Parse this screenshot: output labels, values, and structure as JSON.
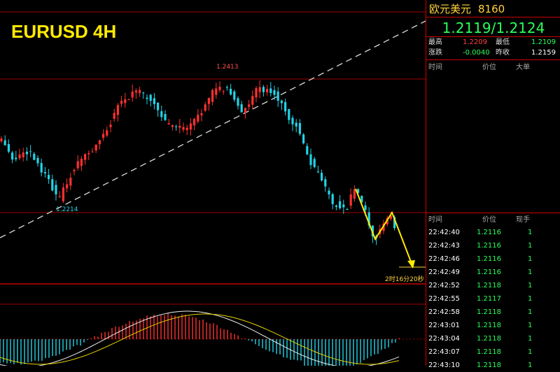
{
  "chart_data": {
    "type": "candlestick",
    "title": "EURUSD 4H",
    "annotations": {
      "high_label": "1.2413",
      "low_label": "1.2214",
      "countdown": "2时16分20秒"
    }
  },
  "panel": {
    "title_name": "欧元美元",
    "title_code": "8160",
    "quote": "1.2119/1.2124",
    "stats": {
      "high_label": "最高",
      "high_value": "1.2209",
      "low_label": "最低",
      "low_value": "1.2109",
      "change_label": "涨跌",
      "change_value": "-0.0040",
      "prev_label": "昨收",
      "prev_value": "1.2159"
    },
    "big_orders_header": {
      "time": "时间",
      "price": "价位",
      "size": "大单"
    },
    "ticks_header": {
      "time": "时间",
      "price": "价位",
      "size": "现手"
    },
    "ticks": [
      {
        "time": "22:42:40",
        "price": "1.2116",
        "size": "1"
      },
      {
        "time": "22:42:43",
        "price": "1.2116",
        "size": "1"
      },
      {
        "time": "22:42:46",
        "price": "1.2116",
        "size": "1"
      },
      {
        "time": "22:42:49",
        "price": "1.2116",
        "size": "1"
      },
      {
        "time": "22:42:52",
        "price": "1.2118",
        "size": "1"
      },
      {
        "time": "22:42:55",
        "price": "1.2117",
        "size": "1"
      },
      {
        "time": "22:42:58",
        "price": "1.2118",
        "size": "1"
      },
      {
        "time": "22:43:01",
        "price": "1.2118",
        "size": "1"
      },
      {
        "time": "22:43:04",
        "price": "1.2118",
        "size": "1"
      },
      {
        "time": "22:43:07",
        "price": "1.2118",
        "size": "1"
      },
      {
        "time": "22:43:10",
        "price": "1.2118",
        "size": "1"
      }
    ]
  },
  "colors": {
    "up": "#ff3030",
    "down": "#22d3e6",
    "accent": "#ffd23c",
    "grid": "#c00000"
  }
}
